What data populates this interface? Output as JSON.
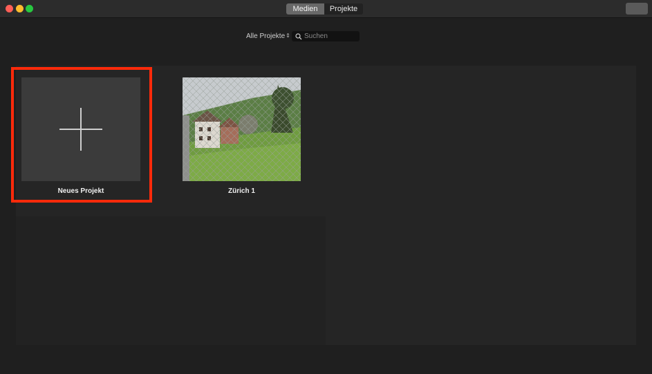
{
  "titlebar": {
    "tabs": [
      {
        "label": "Medien",
        "active": true
      },
      {
        "label": "Projekte",
        "active": false
      }
    ],
    "traffic_colors": {
      "close": "#ff5f57",
      "minimize": "#febc2e",
      "zoom": "#28c840"
    }
  },
  "filter": {
    "label": "Alle Projekte"
  },
  "search": {
    "placeholder": "Suchen",
    "value": ""
  },
  "projects": [
    {
      "label": "Neues Projekt",
      "kind": "new",
      "icon": "plus-icon"
    },
    {
      "label": "Zürich 1",
      "kind": "project"
    }
  ],
  "colors": {
    "highlight": "#ff2a0a"
  }
}
